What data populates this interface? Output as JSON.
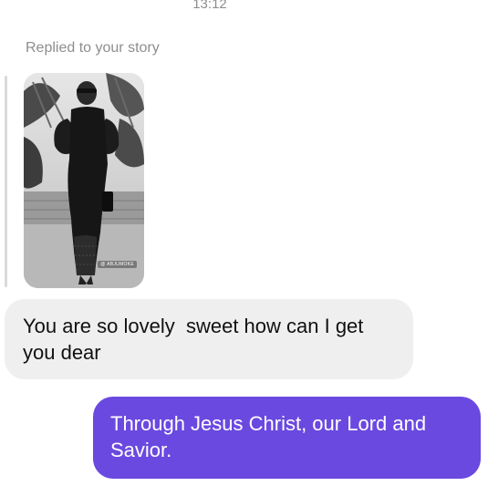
{
  "conversation": {
    "timestamp": "13:12",
    "reply_context": "Replied to your story",
    "story": {
      "tag": "@ ABJUMOKE"
    },
    "messages": [
      {
        "direction": "incoming",
        "text": "You are so lovely  sweet how can I get you dear"
      },
      {
        "direction": "outgoing",
        "text": "Through Jesus Christ, our Lord and Savior."
      }
    ]
  },
  "colors": {
    "incoming_bubble": "#efefef",
    "outgoing_bubble": "#6a49e0",
    "meta_text": "#8e8e8e"
  }
}
